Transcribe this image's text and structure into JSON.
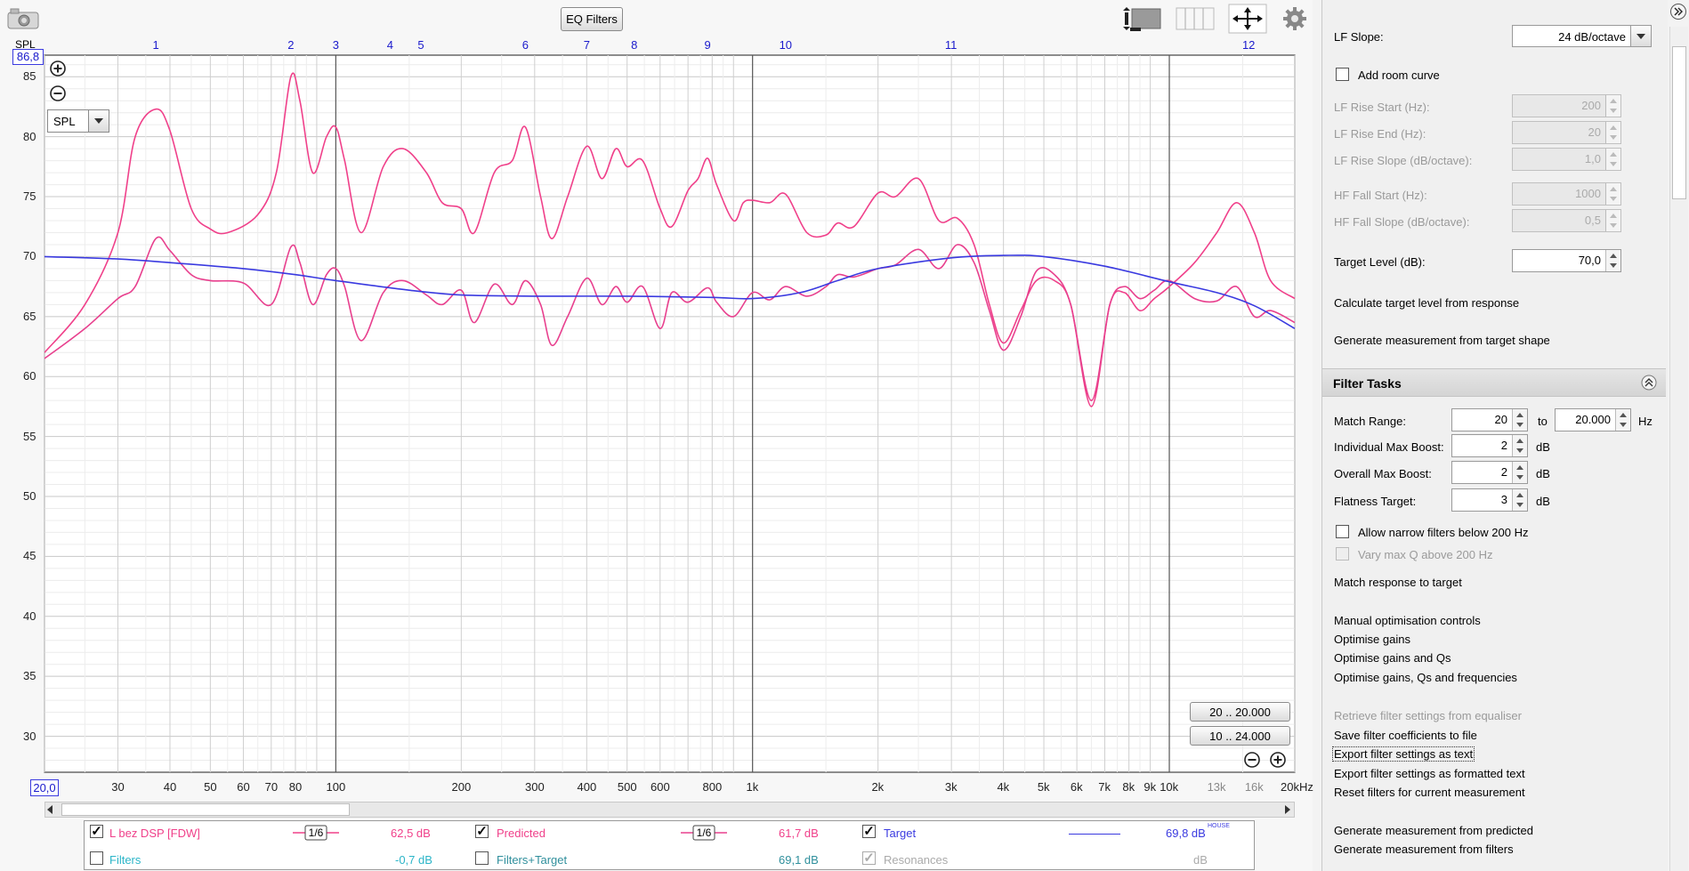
{
  "toolbar": {
    "eq_filters_label": "EQ Filters"
  },
  "graph": {
    "y_axis_title": "SPL",
    "y_top_value": "86,8",
    "x_start_value": "20,0",
    "y_ticks": [
      "85",
      "80",
      "75",
      "70",
      "65",
      "60",
      "55",
      "50",
      "45",
      "40",
      "35",
      "30"
    ],
    "x_ticks": [
      "30",
      "40",
      "50",
      "60",
      "70",
      "80",
      "100",
      "200",
      "300",
      "400",
      "500",
      "600",
      "800",
      "1k",
      "2k",
      "3k",
      "4k",
      "5k",
      "6k",
      "7k",
      "8k",
      "9k",
      "10k",
      "13k",
      "16k",
      "20kHz"
    ],
    "filter_markers": [
      "1",
      "2",
      "3",
      "4",
      "5",
      "6",
      "7",
      "8",
      "9",
      "10",
      "11",
      "12"
    ],
    "selector_value": "SPL",
    "range_buttons": [
      "20 .. 20.000",
      "10 .. 24.000"
    ]
  },
  "legend": {
    "row1": [
      {
        "name": "L bez DSP [FDW]",
        "smoothing": "1/6",
        "value": "62,5 dB",
        "checked": true
      },
      {
        "name": "Predicted",
        "smoothing": "1/6",
        "value": "61,7 dB",
        "checked": true
      },
      {
        "name": "Target",
        "value": "69,8 dB",
        "superscript": "HOUSE",
        "checked": true
      }
    ],
    "row2": [
      {
        "name": "Filters",
        "value": "-0,7 dB",
        "checked": false
      },
      {
        "name": "Filters+Target",
        "value": "69,1 dB",
        "checked": false
      },
      {
        "name": "Resonances",
        "value": "dB",
        "checked": true
      }
    ]
  },
  "panel": {
    "lf_slope_label": "LF Slope:",
    "lf_slope_value": "24 dB/octave",
    "add_room_curve": "Add room curve",
    "lf_rise_start_label": "LF Rise Start (Hz):",
    "lf_rise_start_value": "200",
    "lf_rise_end_label": "LF Rise End (Hz):",
    "lf_rise_end_value": "20",
    "lf_rise_slope_label": "LF Rise Slope (dB/octave):",
    "lf_rise_slope_value": "1,0",
    "hf_fall_start_label": "HF Fall Start (Hz):",
    "hf_fall_start_value": "1000",
    "hf_fall_slope_label": "HF Fall Slope (dB/octave):",
    "hf_fall_slope_value": "0,5",
    "target_level_label": "Target Level (dB):",
    "target_level_value": "70,0",
    "calc_target": "Calculate target level from response",
    "gen_from_target": "Generate measurement from target shape",
    "filter_tasks_title": "Filter Tasks",
    "match_range_label": "Match Range:",
    "match_from": "20",
    "match_to_label": "to",
    "match_to": "20.000",
    "hz_unit": "Hz",
    "ind_max_boost_label": "Individual Max Boost:",
    "ind_max_boost_value": "2",
    "overall_max_boost_label": "Overall Max Boost:",
    "overall_max_boost_value": "2",
    "flatness_label": "Flatness Target:",
    "flatness_value": "3",
    "db_unit": "dB",
    "allow_narrow": "Allow narrow filters below 200 Hz",
    "vary_max_q": "Vary max Q above 200 Hz",
    "match_response": "Match response to target",
    "manual_opt": "Manual optimisation controls",
    "opt_gains": "Optimise gains",
    "opt_gains_qs": "Optimise gains and Qs",
    "opt_gains_qs_freq": "Optimise gains, Qs and frequencies",
    "retrieve": "Retrieve filter settings from equaliser",
    "save_coeffs": "Save filter coefficients to file",
    "export_text": "Export filter settings as text",
    "export_formatted": "Export filter settings as formatted text",
    "reset_filters": "Reset filters for current measurement",
    "gen_predicted": "Generate measurement from predicted",
    "gen_filters": "Generate measurement from filters"
  },
  "colors": {
    "measurement": "#f0408a",
    "predicted": "#e8408e",
    "target": "#3a3ae0",
    "marker_text": "#1a1acc",
    "filters_text": "#2bb5c8"
  },
  "chart_data": {
    "type": "line",
    "x_scale": "log",
    "xlim": [
      20,
      20000
    ],
    "ylim": [
      27,
      86.8
    ],
    "ylabel": "SPL",
    "series": [
      {
        "name": "L bez DSP [FDW]",
        "points": [
          [
            20,
            62
          ],
          [
            25,
            66
          ],
          [
            30,
            72
          ],
          [
            33,
            80
          ],
          [
            37,
            82.3
          ],
          [
            40,
            80.5
          ],
          [
            45,
            74
          ],
          [
            50,
            72.3
          ],
          [
            55,
            72
          ],
          [
            65,
            73.5
          ],
          [
            72,
            77
          ],
          [
            78,
            85
          ],
          [
            82,
            83
          ],
          [
            88,
            77
          ],
          [
            95,
            80
          ],
          [
            100,
            80.8
          ],
          [
            105,
            78
          ],
          [
            115,
            72
          ],
          [
            130,
            77.5
          ],
          [
            145,
            79
          ],
          [
            165,
            77
          ],
          [
            180,
            74.5
          ],
          [
            200,
            74
          ],
          [
            215,
            72
          ],
          [
            240,
            77
          ],
          [
            265,
            78
          ],
          [
            285,
            80.8
          ],
          [
            310,
            75
          ],
          [
            330,
            71.5
          ],
          [
            360,
            75
          ],
          [
            400,
            79.2
          ],
          [
            435,
            76.5
          ],
          [
            470,
            79
          ],
          [
            500,
            77.5
          ],
          [
            545,
            78
          ],
          [
            600,
            74
          ],
          [
            640,
            72.5
          ],
          [
            700,
            75.5
          ],
          [
            740,
            76.5
          ],
          [
            780,
            78.2
          ],
          [
            820,
            76
          ],
          [
            900,
            73
          ],
          [
            950,
            74.5
          ],
          [
            1000,
            74.7
          ],
          [
            1100,
            74.5
          ],
          [
            1200,
            75.2
          ],
          [
            1350,
            72
          ],
          [
            1500,
            71.8
          ],
          [
            1600,
            72.8
          ],
          [
            1750,
            72.5
          ],
          [
            2000,
            75.3
          ],
          [
            2200,
            75
          ],
          [
            2500,
            76.5
          ],
          [
            2800,
            73
          ],
          [
            3100,
            73.2
          ],
          [
            3400,
            71
          ],
          [
            3700,
            66
          ],
          [
            4000,
            62.8
          ],
          [
            4400,
            65.5
          ],
          [
            4800,
            68
          ],
          [
            5300,
            68
          ],
          [
            5800,
            66
          ],
          [
            6500,
            57.5
          ],
          [
            7200,
            66
          ],
          [
            7800,
            67
          ],
          [
            8500,
            65.5
          ],
          [
            9200,
            66.5
          ],
          [
            10000,
            67.5
          ],
          [
            11500,
            69.5
          ],
          [
            13000,
            72
          ],
          [
            14500,
            74.5
          ],
          [
            16000,
            72
          ],
          [
            17500,
            68
          ],
          [
            20000,
            66.5
          ]
        ]
      },
      {
        "name": "Predicted",
        "points": [
          [
            20,
            61.5
          ],
          [
            25,
            64
          ],
          [
            30,
            66.5
          ],
          [
            33,
            67.5
          ],
          [
            37,
            71.5
          ],
          [
            40,
            70.5
          ],
          [
            45,
            68.5
          ],
          [
            50,
            68
          ],
          [
            60,
            67.8
          ],
          [
            70,
            66
          ],
          [
            78,
            70.8
          ],
          [
            82,
            69.5
          ],
          [
            88,
            66
          ],
          [
            95,
            68.5
          ],
          [
            100,
            69
          ],
          [
            105,
            67.5
          ],
          [
            115,
            63
          ],
          [
            130,
            67
          ],
          [
            145,
            68
          ],
          [
            165,
            66.8
          ],
          [
            180,
            66
          ],
          [
            200,
            67.2
          ],
          [
            215,
            64.5
          ],
          [
            240,
            67.7
          ],
          [
            265,
            66
          ],
          [
            285,
            68
          ],
          [
            310,
            66
          ],
          [
            330,
            62.6
          ],
          [
            360,
            65
          ],
          [
            400,
            68.2
          ],
          [
            435,
            66
          ],
          [
            470,
            67.5
          ],
          [
            500,
            66.2
          ],
          [
            545,
            67.5
          ],
          [
            600,
            64
          ],
          [
            640,
            67
          ],
          [
            700,
            66.2
          ],
          [
            780,
            67.4
          ],
          [
            820,
            66.2
          ],
          [
            900,
            65
          ],
          [
            1000,
            67
          ],
          [
            1100,
            66.4
          ],
          [
            1200,
            67.5
          ],
          [
            1350,
            66.7
          ],
          [
            1500,
            67.5
          ],
          [
            1600,
            68.5
          ],
          [
            1750,
            68.3
          ],
          [
            2000,
            69
          ],
          [
            2200,
            69.3
          ],
          [
            2500,
            70.6
          ],
          [
            2800,
            69
          ],
          [
            3100,
            71
          ],
          [
            3400,
            69.5
          ],
          [
            3700,
            65.5
          ],
          [
            4000,
            62.2
          ],
          [
            4400,
            65
          ],
          [
            4800,
            68.8
          ],
          [
            5300,
            68.5
          ],
          [
            5800,
            66
          ],
          [
            6500,
            58
          ],
          [
            7200,
            66
          ],
          [
            7800,
            67.5
          ],
          [
            8500,
            66.5
          ],
          [
            9200,
            67.2
          ],
          [
            10000,
            68
          ],
          [
            11500,
            66.5
          ],
          [
            13000,
            66.3
          ],
          [
            14500,
            67.5
          ],
          [
            16000,
            65
          ],
          [
            17500,
            65.5
          ],
          [
            20000,
            64.5
          ]
        ]
      },
      {
        "name": "Target",
        "points": [
          [
            20,
            70
          ],
          [
            30,
            69.8
          ],
          [
            40,
            69.5
          ],
          [
            60,
            69
          ],
          [
            80,
            68.5
          ],
          [
            100,
            68
          ],
          [
            150,
            67.2
          ],
          [
            200,
            66.8
          ],
          [
            300,
            66.7
          ],
          [
            500,
            66.7
          ],
          [
            800,
            66.6
          ],
          [
            1000,
            66.5
          ],
          [
            1300,
            67
          ],
          [
            1600,
            68
          ],
          [
            2000,
            69
          ],
          [
            3000,
            69.9
          ],
          [
            4000,
            70.1
          ],
          [
            5000,
            70
          ],
          [
            7000,
            69.2
          ],
          [
            10000,
            67.9
          ],
          [
            13000,
            67
          ],
          [
            16000,
            65.9
          ],
          [
            20000,
            64
          ]
        ]
      }
    ]
  }
}
